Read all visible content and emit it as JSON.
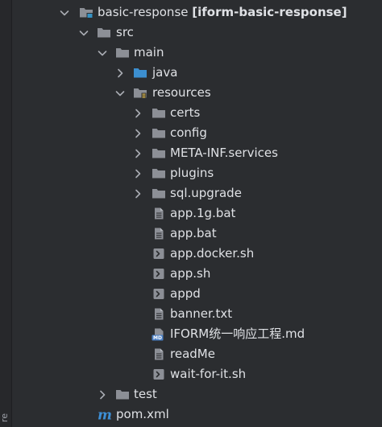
{
  "side_panel": {
    "label": "re"
  },
  "project": {
    "name": "basic-response",
    "module_label": "[iform-basic-response]"
  },
  "nodes": {
    "src": "src",
    "main": "main",
    "java": "java",
    "resources": "resources",
    "certs": "certs",
    "config": "config",
    "meta_inf": "META-INF.services",
    "plugins": "plugins",
    "sql_upgrade": "sql.upgrade",
    "app_1g_bat": "app.1g.bat",
    "app_bat": "app.bat",
    "app_docker_sh": "app.docker.sh",
    "app_sh": "app.sh",
    "appd": "appd",
    "banner_txt": "banner.txt",
    "iform_md": "IFORM统一响应工程.md",
    "readme": "readMe",
    "wait_for_it": "wait-for-it.sh",
    "test": "test",
    "pom": "pom.xml"
  },
  "colors": {
    "background": "#2b2d30",
    "text": "#dfe1e5",
    "folder": "#8c8f96",
    "source_folder": "#3c8fd0",
    "module_badge": "#3592c4",
    "maven": "#3d8fd6",
    "md_badge": "#4a7fc4"
  }
}
